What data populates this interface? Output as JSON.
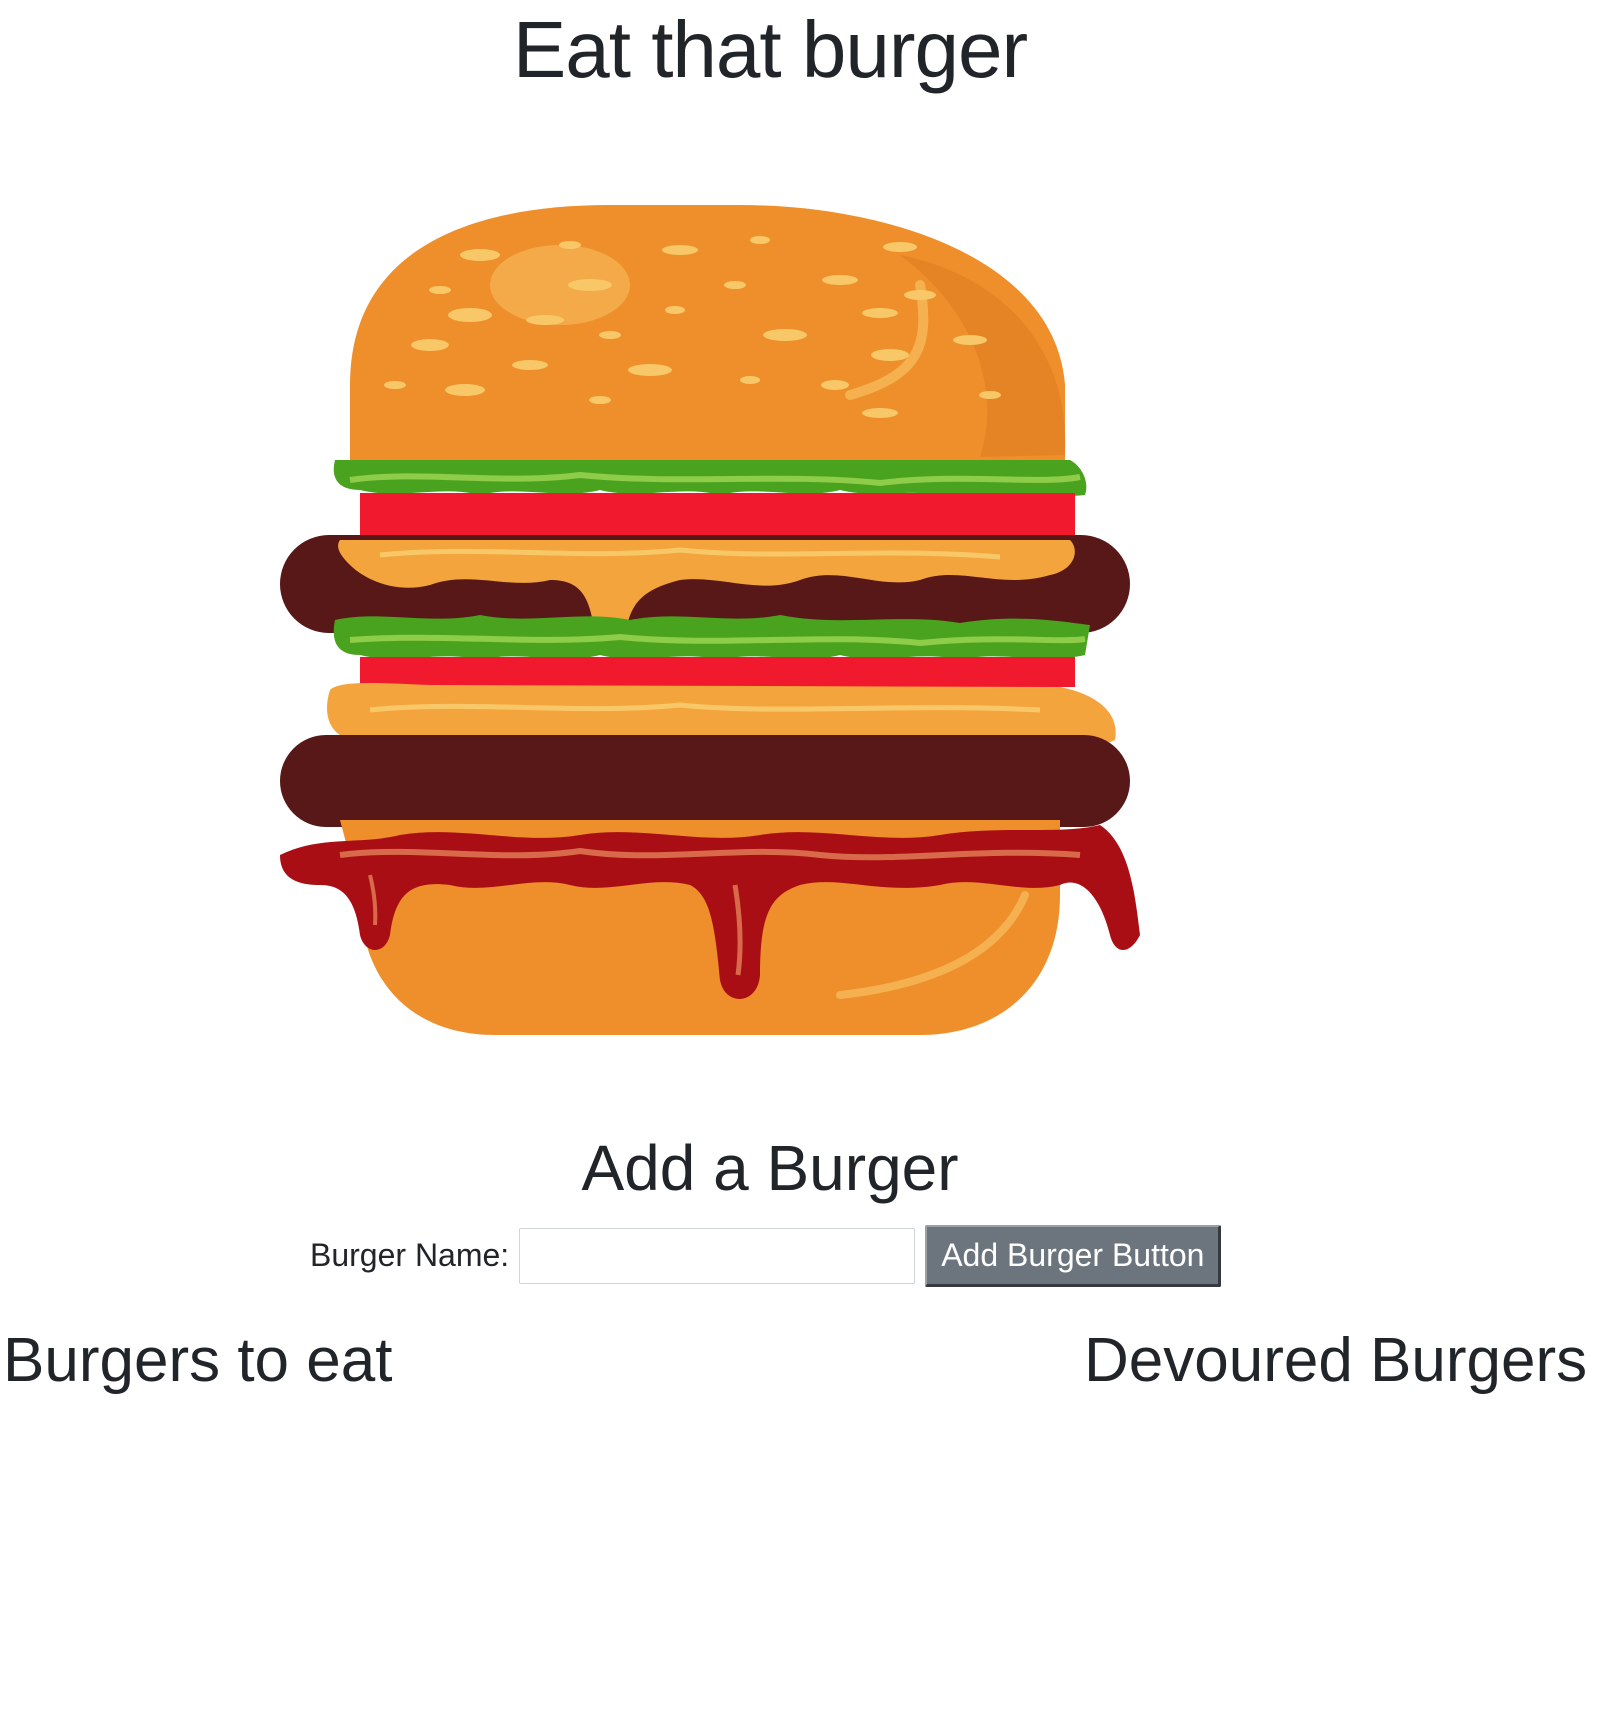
{
  "page": {
    "title": "Eat that burger"
  },
  "hero": {
    "image_icon": "burger-illustration"
  },
  "add_section": {
    "title": "Add a Burger",
    "label": "Burger Name:",
    "input_value": "",
    "input_placeholder": "",
    "button_label": "Add Burger Button"
  },
  "columns": {
    "to_eat": {
      "heading": "Burgers to eat",
      "items": []
    },
    "devoured": {
      "heading": "Devoured Burgers",
      "items": []
    }
  },
  "colors": {
    "text": "#212529",
    "button_bg": "#6c757d",
    "button_text": "#ffffff",
    "input_border": "#ced4da"
  }
}
